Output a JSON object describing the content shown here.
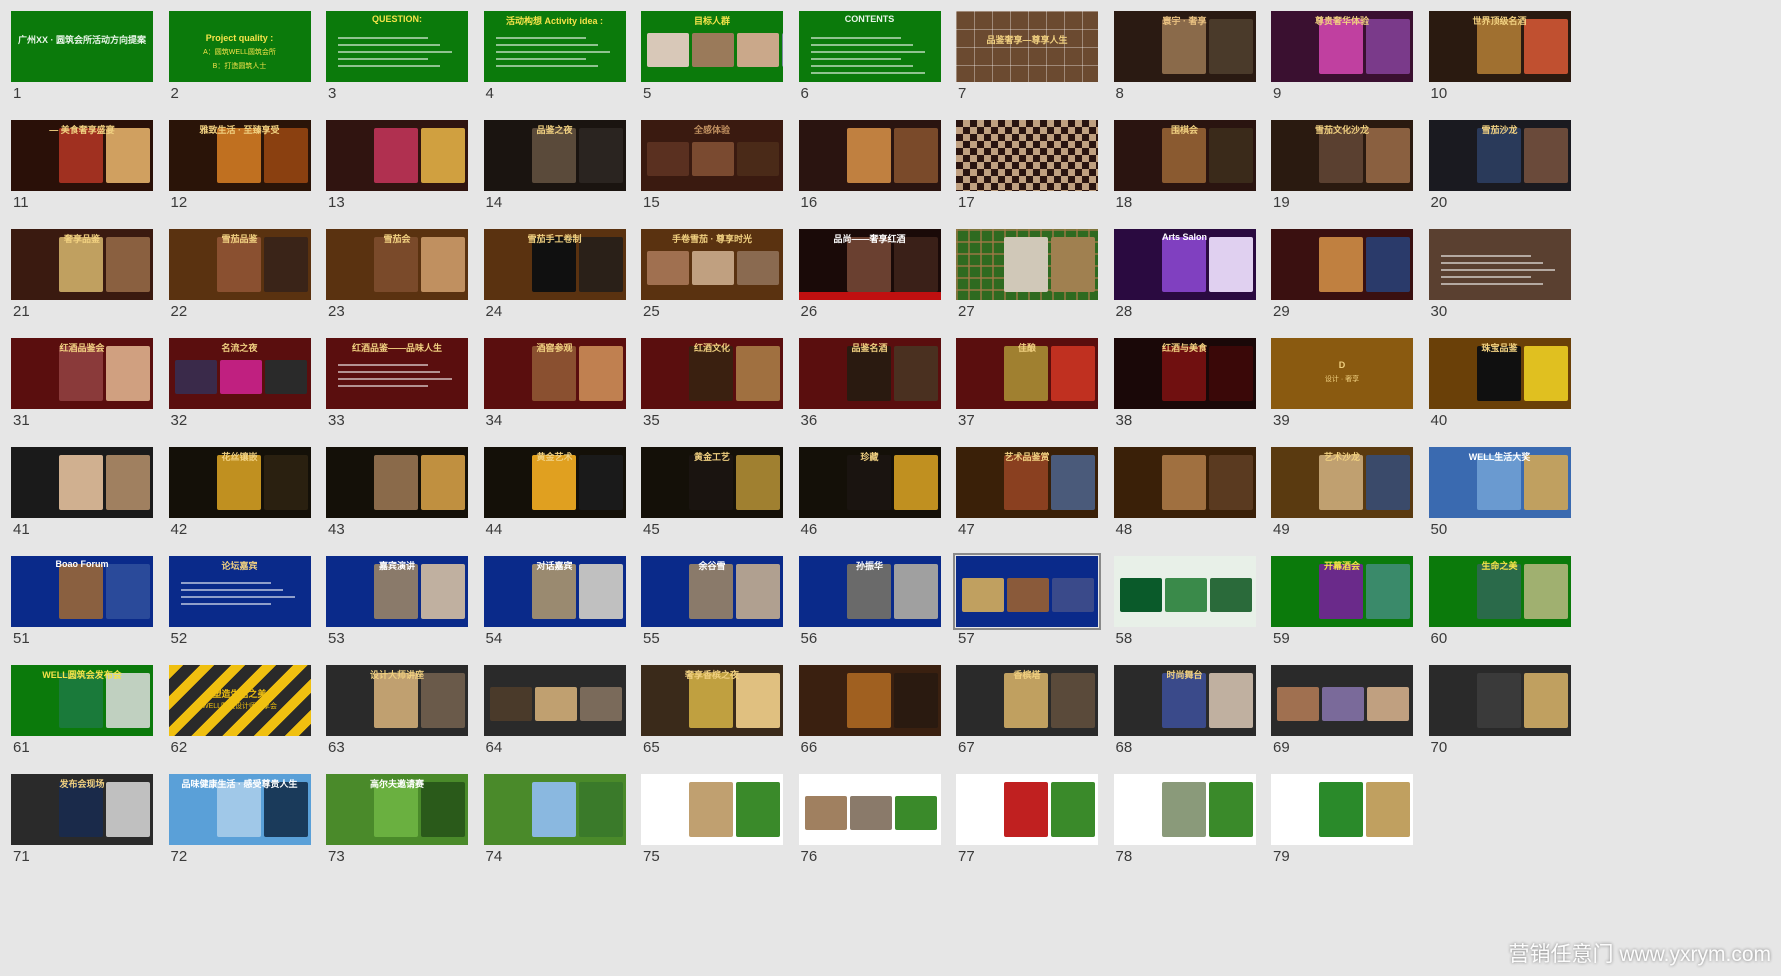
{
  "watermark": "营销任意门 www.yxrym.com",
  "selected": 57,
  "slides": [
    {
      "n": "1",
      "bg": "#0b7a0b",
      "t": [
        "广州XX · 圆筑会所活动方向提案"
      ],
      "tc": "#e8f5e8"
    },
    {
      "n": "2",
      "bg": "#0b7a0b",
      "t": [
        "Project quality :",
        "A：圆筑WELL圆筑会所",
        "B：打造圆筑人士"
      ],
      "tc": "#f5e34a"
    },
    {
      "n": "3",
      "bg": "#0b7a0b",
      "t": [
        "QUESTION:"
      ],
      "tc": "#f5e34a",
      "lines": 5
    },
    {
      "n": "4",
      "bg": "#0b7a0b",
      "t": [
        "活动构想 Activity idea :"
      ],
      "tc": "#f5e34a",
      "lines": 5
    },
    {
      "n": "5",
      "bg": "#0b7a0b",
      "t": [
        "目标人群"
      ],
      "tc": "#f5e34a",
      "photos": [
        "#d8c8b8",
        "#9a7a5a",
        "#caa88a",
        "#7a8aa0"
      ]
    },
    {
      "n": "6",
      "bg": "#0b7a0b",
      "t": [
        "CONTENTS"
      ],
      "tc": "#e8f5e8",
      "lines": 6
    },
    {
      "n": "7",
      "bg": "#6b4a30",
      "t": [
        "品鉴奢享—尊享人生"
      ],
      "tc": "#f0d080",
      "pattern": "grid"
    },
    {
      "n": "8",
      "bg": "#2a1a12",
      "t": [
        "寰宇 · 奢享"
      ],
      "tc": "#e8c080",
      "photos": [
        "#8a6a4a",
        "#4a3a2a"
      ]
    },
    {
      "n": "9",
      "bg": "#3a1030",
      "t": [
        "尊贵奢华体验"
      ],
      "tc": "#f0d080",
      "photos": [
        "#c040a0",
        "#7a3a8a"
      ]
    },
    {
      "n": "10",
      "bg": "#2a1a10",
      "t": [
        "世界顶级名酒"
      ],
      "tc": "#f0d080",
      "photos": [
        "#a07030",
        "#c05030"
      ]
    },
    {
      "n": "11",
      "bg": "#2a1008",
      "t": [
        "— 美食奢享盛宴"
      ],
      "tc": "#f0d080",
      "photos": [
        "#a03020",
        "#d0a060"
      ]
    },
    {
      "n": "12",
      "bg": "#2a1408",
      "t": [
        "雅致生活 · 至臻享受"
      ],
      "tc": "#f0d080",
      "photos": [
        "#c07020",
        "#8a4010"
      ]
    },
    {
      "n": "13",
      "bg": "#301410",
      "t": [
        ""
      ],
      "tc": "#f0d080",
      "photos": [
        "#b03050",
        "#d0a040"
      ]
    },
    {
      "n": "14",
      "bg": "#1a1410",
      "t": [
        "品鉴之夜"
      ],
      "tc": "#f0d080",
      "photos": [
        "#5a4a3a",
        "#2a2420"
      ]
    },
    {
      "n": "15",
      "bg": "#3a1a10",
      "t": [
        "全感体验"
      ],
      "tc": "#c09060",
      "photos": [
        "#5a3020",
        "#7a4a30",
        "#4a2a18"
      ]
    },
    {
      "n": "16",
      "bg": "#2a1410",
      "t": [
        ""
      ],
      "tc": "#f0d080",
      "photos": [
        "#c08040",
        "#7a4a2a"
      ]
    },
    {
      "n": "17",
      "bg": "#2a1410",
      "t": [
        ""
      ],
      "tc": "#f0d080",
      "pattern": "checker"
    },
    {
      "n": "18",
      "bg": "#2a1410",
      "t": [
        "围棋会"
      ],
      "tc": "#f0d080",
      "photos": [
        "#8a5a30",
        "#3a2a1a"
      ]
    },
    {
      "n": "19",
      "bg": "#2a1a10",
      "t": [
        "雪茄文化沙龙"
      ],
      "tc": "#f0d080",
      "photos": [
        "#5a4030",
        "#8a6040"
      ]
    },
    {
      "n": "20",
      "bg": "#1a1a20",
      "t": [
        "雪茄沙龙"
      ],
      "tc": "#f0d080",
      "photos": [
        "#2a3a5a",
        "#6a4a3a"
      ]
    },
    {
      "n": "21",
      "bg": "#3a1a10",
      "t": [
        "奢享品鉴"
      ],
      "tc": "#f0d080",
      "photos": [
        "#c0a060",
        "#8a6040"
      ]
    },
    {
      "n": "22",
      "bg": "#5a3210",
      "t": [
        "雪茄品鉴"
      ],
      "tc": "#f0d080",
      "photos": [
        "#8a5030",
        "#3a2418"
      ]
    },
    {
      "n": "23",
      "bg": "#5a3210",
      "t": [
        "雪茄会"
      ],
      "tc": "#f0d080",
      "photos": [
        "#7a4a2a",
        "#c09060"
      ]
    },
    {
      "n": "24",
      "bg": "#5a3210",
      "t": [
        "雪茄手工卷制"
      ],
      "tc": "#f0d080",
      "photos": [
        "#101010",
        "#2a2018"
      ]
    },
    {
      "n": "25",
      "bg": "#5a3210",
      "t": [
        "手卷雪茄 · 尊享时光"
      ],
      "tc": "#f0d080",
      "photos": [
        "#a07050",
        "#c0a080",
        "#8a6a50"
      ]
    },
    {
      "n": "26",
      "bg": "#1a0a08",
      "t": [
        "品尚——奢享红酒"
      ],
      "tc": "#ffffff",
      "photos": [
        "#6a4030",
        "#3a2018"
      ],
      "bar": "#c01010"
    },
    {
      "n": "27",
      "bg": "#2e6a20",
      "t": [
        ""
      ],
      "tc": "#ffffff",
      "photos": [
        "#d0c8b8",
        "#a08050"
      ],
      "pattern": "wall"
    },
    {
      "n": "28",
      "bg": "#2a0a40",
      "t": [
        "Arts Salon"
      ],
      "tc": "#ffffff",
      "photos": [
        "#8040c0",
        "#e0d0f0"
      ]
    },
    {
      "n": "29",
      "bg": "#3a1010",
      "t": [
        ""
      ],
      "tc": "#f0d080",
      "photos": [
        "#c08040",
        "#2a3a6a"
      ]
    },
    {
      "n": "30",
      "bg": "#5a4030",
      "t": [
        ""
      ],
      "tc": "#f0d080",
      "lines": 5
    },
    {
      "n": "31",
      "bg": "#5a0e0e",
      "t": [
        "红酒品鉴会"
      ],
      "tc": "#f0d080",
      "photos": [
        "#8a3a3a",
        "#d0a080"
      ]
    },
    {
      "n": "32",
      "bg": "#5a0e0e",
      "t": [
        "名流之夜"
      ],
      "tc": "#f0d080",
      "photos": [
        "#3a2a4a",
        "#c02080",
        "#2a2a2a"
      ]
    },
    {
      "n": "33",
      "bg": "#5a0e0e",
      "t": [
        "红酒品鉴——品味人生"
      ],
      "tc": "#f0d080",
      "lines": 4
    },
    {
      "n": "34",
      "bg": "#5a0e0e",
      "t": [
        "酒窖参观"
      ],
      "tc": "#f0d080",
      "photos": [
        "#8a5030",
        "#c08050"
      ]
    },
    {
      "n": "35",
      "bg": "#5a0e0e",
      "t": [
        "红酒文化"
      ],
      "tc": "#f0d080",
      "photos": [
        "#3a2010",
        "#a07040"
      ]
    },
    {
      "n": "36",
      "bg": "#5a0e0e",
      "t": [
        "品鉴名酒"
      ],
      "tc": "#f0d080",
      "photos": [
        "#2a1a10",
        "#4a3020"
      ]
    },
    {
      "n": "37",
      "bg": "#5a0e0e",
      "t": [
        "佳酿"
      ],
      "tc": "#f0d080",
      "photos": [
        "#a08030",
        "#c03020"
      ]
    },
    {
      "n": "38",
      "bg": "#1a0808",
      "t": [
        "红酒与美食"
      ],
      "tc": "#f0d080",
      "photos": [
        "#701010",
        "#3a0808"
      ]
    },
    {
      "n": "39",
      "bg": "#8a5a10",
      "t": [
        "D",
        "设计 · 奢享"
      ],
      "tc": "#f0d080"
    },
    {
      "n": "40",
      "bg": "#6a4008",
      "t": [
        "珠宝品鉴"
      ],
      "tc": "#f0d080",
      "photos": [
        "#101010",
        "#e0c020"
      ]
    },
    {
      "n": "41",
      "bg": "#1a1a1a",
      "t": [
        ""
      ],
      "tc": "#ffffff",
      "photos": [
        "#d0b090",
        "#a08060"
      ]
    },
    {
      "n": "42",
      "bg": "#141008",
      "t": [
        "花丝镶嵌"
      ],
      "tc": "#f0d080",
      "photos": [
        "#c09020",
        "#2a2010"
      ]
    },
    {
      "n": "43",
      "bg": "#141008",
      "t": [
        ""
      ],
      "tc": "#f0d080",
      "photos": [
        "#8a6a4a",
        "#c09040"
      ]
    },
    {
      "n": "44",
      "bg": "#141008",
      "t": [
        "黄金艺术"
      ],
      "tc": "#f0d080",
      "photos": [
        "#e0a020",
        "#1a1a1a"
      ]
    },
    {
      "n": "45",
      "bg": "#141008",
      "t": [
        "黄金工艺"
      ],
      "tc": "#f0d080",
      "photos": [
        "#1a1410",
        "#a08030"
      ]
    },
    {
      "n": "46",
      "bg": "#141008",
      "t": [
        "珍藏"
      ],
      "tc": "#f0d080",
      "photos": [
        "#1a1410",
        "#c09020"
      ]
    },
    {
      "n": "47",
      "bg": "#3a2008",
      "t": [
        "艺术品鉴赏"
      ],
      "tc": "#f0d080",
      "photos": [
        "#8a4020",
        "#4a5a7a"
      ]
    },
    {
      "n": "48",
      "bg": "#3a2008",
      "t": [
        ""
      ],
      "tc": "#f0d080",
      "photos": [
        "#a07040",
        "#5a3a20"
      ]
    },
    {
      "n": "49",
      "bg": "#5a3a10",
      "t": [
        "艺术沙龙"
      ],
      "tc": "#f0d080",
      "photos": [
        "#c0a070",
        "#3a4a6a"
      ]
    },
    {
      "n": "50",
      "bg": "#3a6ab0",
      "t": [
        "WELL生活大奖"
      ],
      "tc": "#ffffff",
      "photos": [
        "#6a9ad0",
        "#c0a060"
      ]
    },
    {
      "n": "51",
      "bg": "#0a2a8a",
      "t": [
        "Boao Forum"
      ],
      "tc": "#ffffff",
      "photos": [
        "#8a6040",
        "#2a4a9a"
      ]
    },
    {
      "n": "52",
      "bg": "#0a2a8a",
      "t": [
        "论坛嘉宾"
      ],
      "tc": "#f0d080",
      "lines": 4
    },
    {
      "n": "53",
      "bg": "#0a2a8a",
      "t": [
        "嘉宾演讲"
      ],
      "tc": "#ffffff",
      "photos": [
        "#8a7a6a",
        "#c0b0a0"
      ]
    },
    {
      "n": "54",
      "bg": "#0a2a8a",
      "t": [
        "对话嘉宾"
      ],
      "tc": "#ffffff",
      "photos": [
        "#9a8a70",
        "#c0c0c0"
      ]
    },
    {
      "n": "55",
      "bg": "#0a2a8a",
      "t": [
        "余谷雪"
      ],
      "tc": "#ffffff",
      "photos": [
        "#8a7a6a",
        "#b0a090"
      ]
    },
    {
      "n": "56",
      "bg": "#0a2a8a",
      "t": [
        "孙振华"
      ],
      "tc": "#ffffff",
      "photos": [
        "#6a6a6a",
        "#a0a0a0"
      ]
    },
    {
      "n": "57",
      "bg": "#0a2a8a",
      "t": [
        ""
      ],
      "tc": "#ffffff",
      "photos": [
        "#c0a060",
        "#8a5a3a",
        "#3a4a8a"
      ]
    },
    {
      "n": "58",
      "bg": "#e8f0e8",
      "t": [
        ""
      ],
      "tc": "#0a6a0a",
      "photos": [
        "#0a5a2a",
        "#3a8a4a",
        "#2a6a3a"
      ]
    },
    {
      "n": "59",
      "bg": "#0b7a0b",
      "t": [
        "开幕酒会"
      ],
      "tc": "#f5e34a",
      "photos": [
        "#6a2a8a",
        "#3a8a6a"
      ]
    },
    {
      "n": "60",
      "bg": "#0b7a0b",
      "t": [
        "生命之美"
      ],
      "tc": "#f5e34a",
      "photos": [
        "#2a6a4a",
        "#a0b070"
      ]
    },
    {
      "n": "61",
      "bg": "#0b7a0b",
      "t": [
        "WELL圆筑会发布会"
      ],
      "tc": "#f5e34a",
      "photos": [
        "#1a7a3a",
        "#c0d0c0"
      ]
    },
    {
      "n": "62",
      "bg": "#2a2a2a",
      "t": [
        "塑造生活之美",
        "WELL圆筑设计师分享会"
      ],
      "tc": "#f0c010",
      "pattern": "stripes"
    },
    {
      "n": "63",
      "bg": "#2a2a2a",
      "t": [
        "设计大师讲座"
      ],
      "tc": "#f0d080",
      "photos": [
        "#c0a070",
        "#6a5a4a"
      ]
    },
    {
      "n": "64",
      "bg": "#2a2a2a",
      "t": [
        ""
      ],
      "tc": "#f0d080",
      "photos": [
        "#4a3a2a",
        "#c0a070",
        "#7a6a5a"
      ]
    },
    {
      "n": "65",
      "bg": "#3a2a1a",
      "t": [
        "奢享香槟之夜"
      ],
      "tc": "#f0d080",
      "photos": [
        "#c0a040",
        "#e0c080"
      ]
    },
    {
      "n": "66",
      "bg": "#3a2010",
      "t": [
        ""
      ],
      "tc": "#f0d080",
      "photos": [
        "#a06020",
        "#2a1a10"
      ]
    },
    {
      "n": "67",
      "bg": "#2a2a2a",
      "t": [
        "香槟塔"
      ],
      "tc": "#f0d080",
      "photos": [
        "#c0a060",
        "#5a4a3a"
      ]
    },
    {
      "n": "68",
      "bg": "#2a2a2a",
      "t": [
        "时尚舞台"
      ],
      "tc": "#f0d080",
      "photos": [
        "#3a4a8a",
        "#c0b0a0"
      ]
    },
    {
      "n": "69",
      "bg": "#2a2a2a",
      "t": [
        ""
      ],
      "tc": "#f0d080",
      "photos": [
        "#a07050",
        "#7a6a9a",
        "#c0a080"
      ]
    },
    {
      "n": "70",
      "bg": "#2a2a2a",
      "t": [
        ""
      ],
      "tc": "#f0d080",
      "photos": [
        "#3a3a3a",
        "#c0a060"
      ]
    },
    {
      "n": "71",
      "bg": "#2a2a2a",
      "t": [
        "发布会现场"
      ],
      "tc": "#f0d080",
      "photos": [
        "#1a2a4a",
        "#c0c0c0"
      ]
    },
    {
      "n": "72",
      "bg": "#5aa0d8",
      "t": [
        "品味健康生活 · 感受尊贵人生"
      ],
      "tc": "#ffffff",
      "photos": [
        "#a0c8e8",
        "#1a3a5a"
      ]
    },
    {
      "n": "73",
      "bg": "#4a8a2a",
      "t": [
        "高尔夫邀请赛"
      ],
      "tc": "#ffffff",
      "photos": [
        "#6ab040",
        "#2a5a1a"
      ]
    },
    {
      "n": "74",
      "bg": "#4a8a2a",
      "t": [
        ""
      ],
      "tc": "#ffffff",
      "photos": [
        "#8ab8e0",
        "#3a7a2a"
      ]
    },
    {
      "n": "75",
      "bg": "#ffffff",
      "t": [
        ""
      ],
      "tc": "#333333",
      "photos": [
        "#c0a070",
        "#3a8a2a"
      ]
    },
    {
      "n": "76",
      "bg": "#ffffff",
      "t": [
        ""
      ],
      "tc": "#333333",
      "photos": [
        "#a08060",
        "#8a7a6a",
        "#3a8a2a"
      ]
    },
    {
      "n": "77",
      "bg": "#ffffff",
      "t": [
        ""
      ],
      "tc": "#333333",
      "photos": [
        "#c02020",
        "#3a8a2a"
      ]
    },
    {
      "n": "78",
      "bg": "#ffffff",
      "t": [
        ""
      ],
      "tc": "#333333",
      "photos": [
        "#8a9a7a",
        "#3a8a2a"
      ]
    },
    {
      "n": "79",
      "bg": "#ffffff",
      "t": [
        ""
      ],
      "tc": "#333333",
      "photos": [
        "#2a8a2a",
        "#c0a060"
      ]
    }
  ]
}
